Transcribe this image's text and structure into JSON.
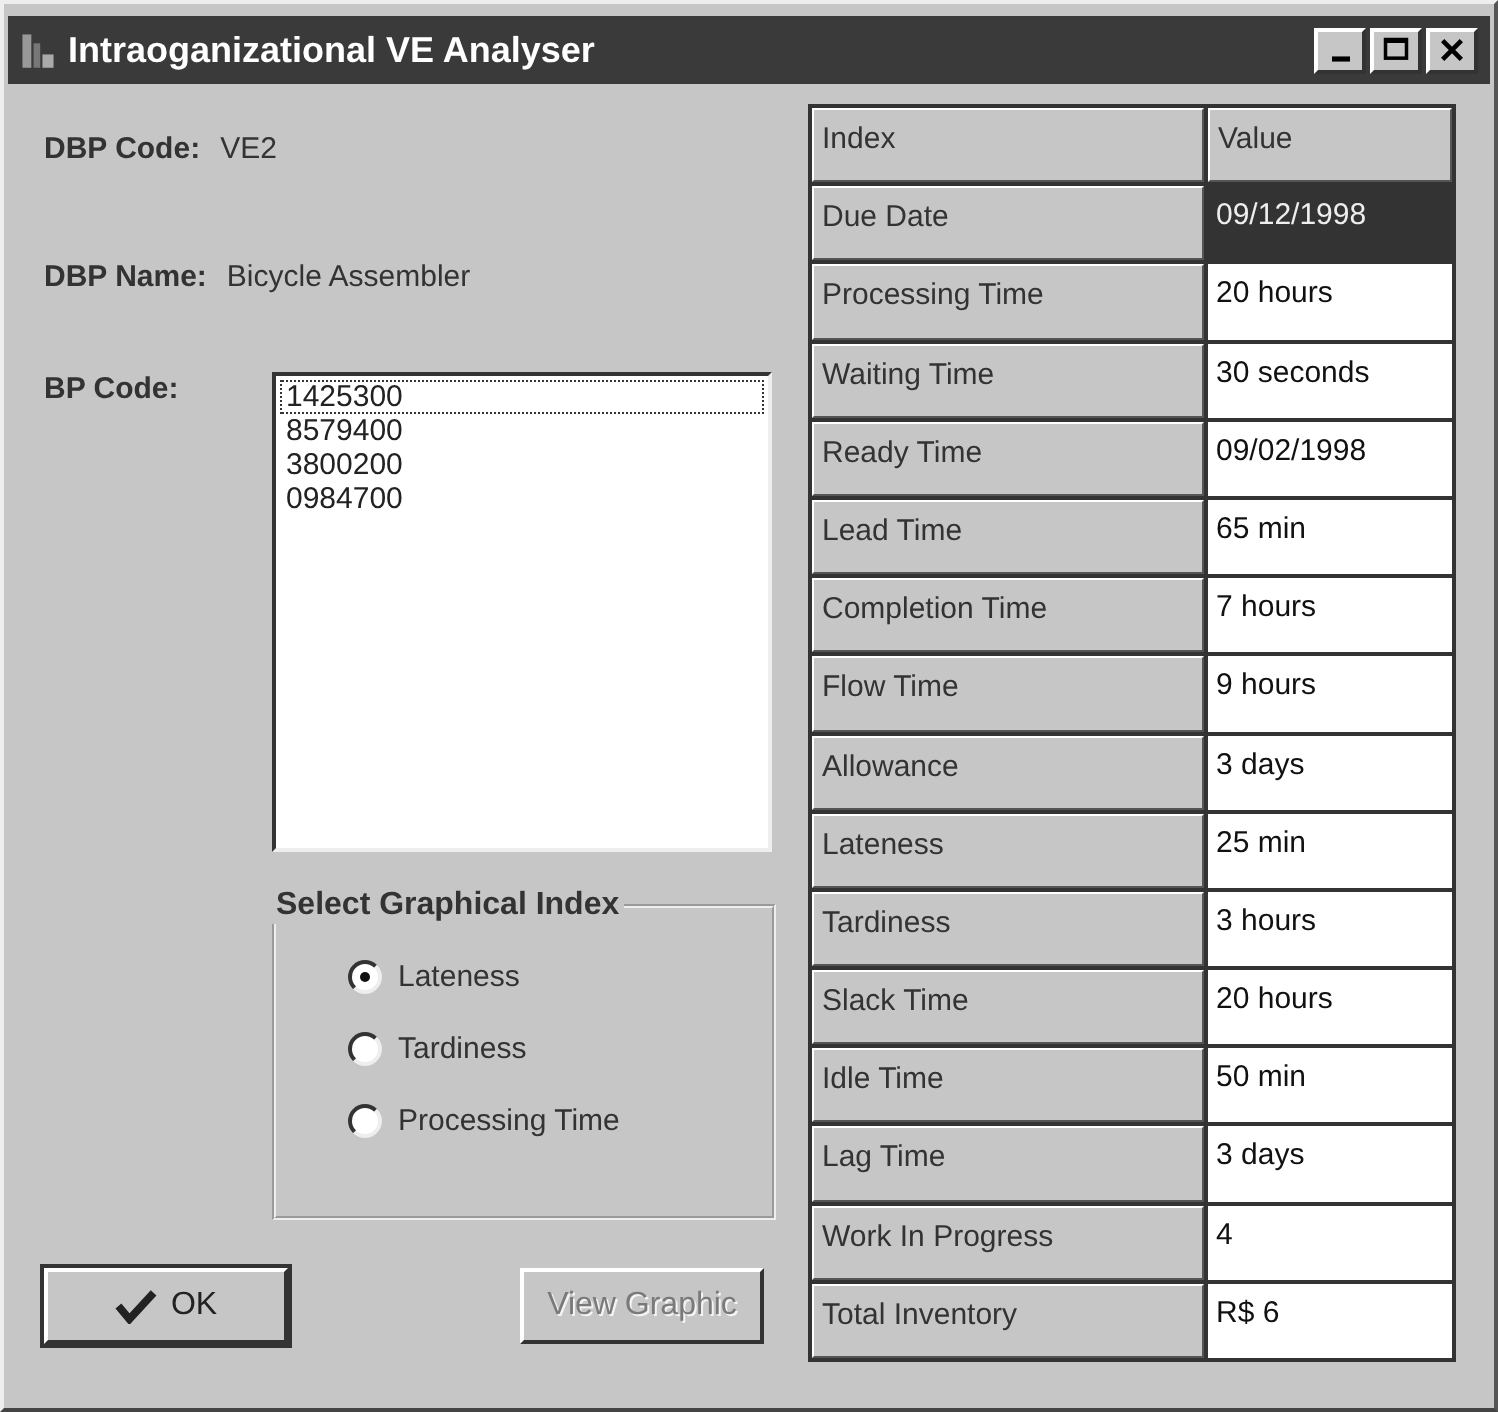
{
  "window": {
    "title": "Intraoganizational VE Analyser"
  },
  "fields": [
    {
      "label": "DBP Code:",
      "value": "VE2"
    },
    {
      "label": "DBP Name:",
      "value": "Bicycle Assembler"
    }
  ],
  "bp_code": {
    "label": "BP Code:",
    "items": [
      {
        "text": "1425300",
        "selected": true
      },
      {
        "text": "8579400",
        "selected": false
      },
      {
        "text": "3800200",
        "selected": false
      },
      {
        "text": "0984700",
        "selected": false
      }
    ]
  },
  "graphical_index": {
    "title": "Select Graphical Index",
    "options": [
      {
        "label": "Lateness",
        "selected": true
      },
      {
        "label": "Tardiness",
        "selected": false
      },
      {
        "label": "Processing Time",
        "selected": false
      }
    ]
  },
  "buttons": [
    {
      "label": "OK",
      "disabled": false
    },
    {
      "label": "View Graphic",
      "disabled": true
    }
  ],
  "table": {
    "columns": [
      "Index",
      "Value"
    ],
    "rows": [
      {
        "index": "Due Date",
        "value": "09/12/1998",
        "selected": true
      },
      {
        "index": "Processing Time",
        "value": "20 hours",
        "selected": false
      },
      {
        "index": "Waiting Time",
        "value": "30 seconds",
        "selected": false
      },
      {
        "index": "Ready Time",
        "value": "09/02/1998",
        "selected": false
      },
      {
        "index": "Lead Time",
        "value": "65 min",
        "selected": false
      },
      {
        "index": "Completion Time",
        "value": "7 hours",
        "selected": false
      },
      {
        "index": "Flow Time",
        "value": "9 hours",
        "selected": false
      },
      {
        "index": "Allowance",
        "value": "3 days",
        "selected": false
      },
      {
        "index": "Lateness",
        "value": "25 min",
        "selected": false
      },
      {
        "index": "Tardiness",
        "value": "3 hours",
        "selected": false
      },
      {
        "index": "Slack Time",
        "value": "20 hours",
        "selected": false
      },
      {
        "index": "Idle Time",
        "value": "50 min",
        "selected": false
      },
      {
        "index": "Lag Time",
        "value": "3 days",
        "selected": false
      },
      {
        "index": "Work In Progress",
        "value": "4",
        "selected": false
      },
      {
        "index": "Total Inventory",
        "value": "R$ 6",
        "selected": false
      }
    ]
  }
}
